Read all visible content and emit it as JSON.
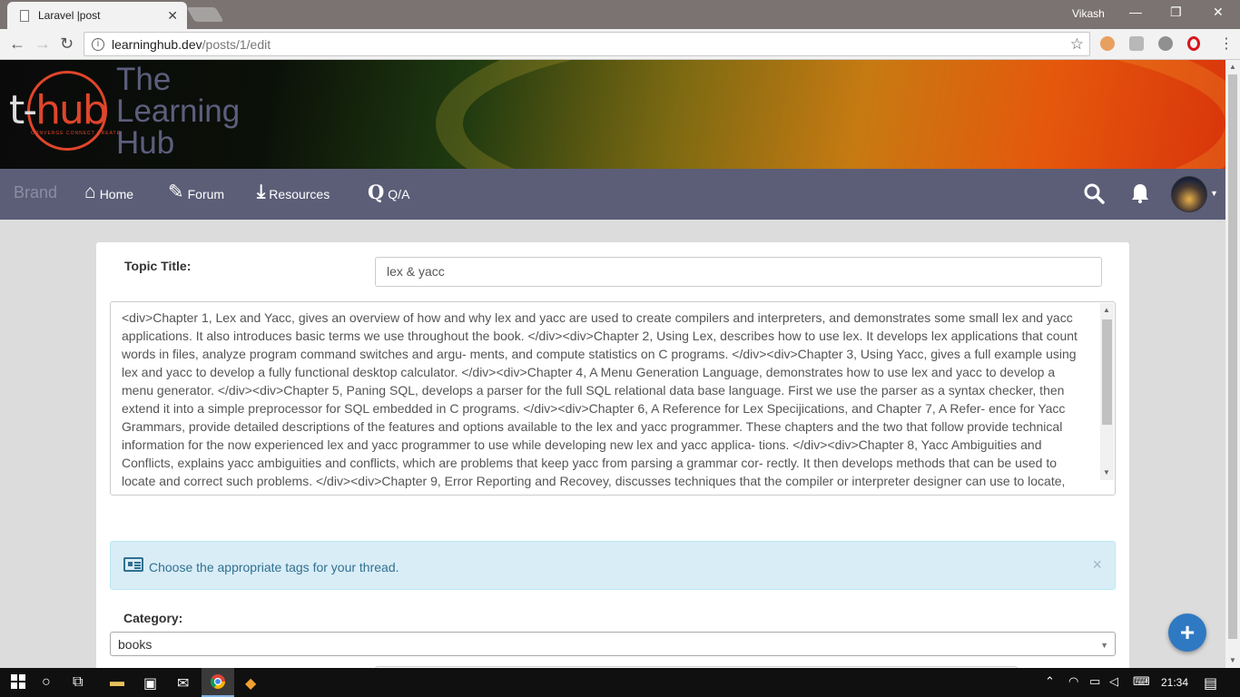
{
  "browser": {
    "tab_title": "Laravel |post",
    "profile_name": "Vikash",
    "url_host": "learninghub.dev",
    "url_path": "/posts/1/edit"
  },
  "banner": {
    "logo_text_t": "t-",
    "logo_text_hub": "hub",
    "logo_subtext": "CONVERGE CONNECT CREATE",
    "title_lines": [
      "The",
      "Learning",
      "Hub"
    ]
  },
  "navbar": {
    "brand": "Brand",
    "items": [
      {
        "label": "Home",
        "icon": "home-icon"
      },
      {
        "label": "Forum",
        "icon": "edit-icon"
      },
      {
        "label": "Resources",
        "icon": "download-icon"
      },
      {
        "label": "Q/A",
        "icon": "q-icon"
      }
    ]
  },
  "form": {
    "topic_title_label": "Topic Title:",
    "topic_title_value": "lex & yacc",
    "body_lines": [
      "<div>Chapter 1, Lex and Yacc, gives an overview of how and why lex and yacc are used to create compilers and interpreters, and demonstrates some small lex and yacc",
      "applications. It also introduces basic terms we use throughout the book. </div><div>Chapter 2, Using Lex, describes how to use lex. It develops lex applications that count",
      "words in files, analyze program command switches and argu- ments, and compute statistics on C programs. </div><div>Chapter 3, Using Yacc, gives a full example using",
      "lex and yacc to develop a fully functional desktop calculator. </div><div>Chapter 4, A Menu Generation Language, demonstrates how to use lex and yacc to develop a",
      "menu generator. </div><div>Chapter 5, Paning SQL, develops a parser for the full SQL relational data base language. First we use the parser as a syntax checker, then",
      "extend it into a simple preprocessor for SQL embedded in C programs. </div><div>Chapter 6, A Reference for Lex Specijications, and Chapter 7, A Refer- ence for Yacc",
      "Grammars, provide detailed descriptions of the features and options available to the lex and yacc programmer. These chapters and the two that follow provide technical",
      "information for the now experienced lex and yacc programmer to use while developing new lex and yacc applica- tions. </div><div>Chapter 8, Yacc Ambiguities and",
      "Conflicts, explains yacc ambiguities and conflicts, which are problems that keep yacc from parsing a grammar cor- rectly. It then develops methods that can be used to",
      "locate and correct such problems. </div><div>Chapter 9, Error Reporting and Recovey, discusses techniques that the compiler or interpreter designer can use to locate,"
    ],
    "alert_text": "Choose the appropriate tags for your thread.",
    "alert_close": "×",
    "category_label": "Category:",
    "category_value": "books"
  },
  "fab": {
    "label": "+"
  },
  "taskbar": {
    "time": "21:34"
  }
}
